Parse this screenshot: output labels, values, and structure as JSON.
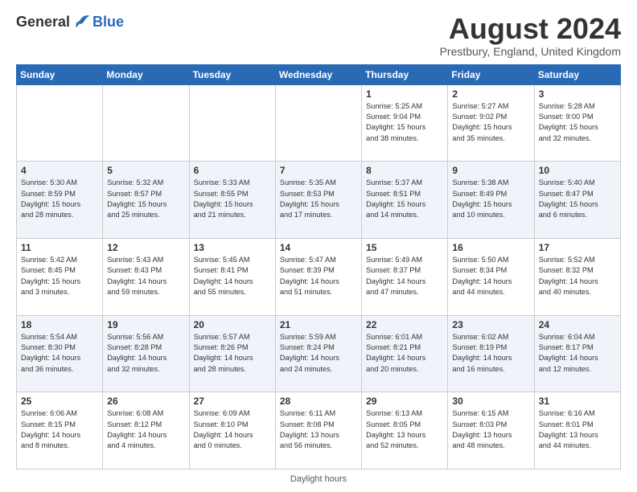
{
  "header": {
    "logo": {
      "general": "General",
      "blue": "Blue"
    },
    "title": "August 2024",
    "location": "Prestbury, England, United Kingdom"
  },
  "days_of_week": [
    "Sunday",
    "Monday",
    "Tuesday",
    "Wednesday",
    "Thursday",
    "Friday",
    "Saturday"
  ],
  "weeks": [
    [
      {
        "day": "",
        "info": ""
      },
      {
        "day": "",
        "info": ""
      },
      {
        "day": "",
        "info": ""
      },
      {
        "day": "",
        "info": ""
      },
      {
        "day": "1",
        "info": "Sunrise: 5:25 AM\nSunset: 9:04 PM\nDaylight: 15 hours\nand 38 minutes."
      },
      {
        "day": "2",
        "info": "Sunrise: 5:27 AM\nSunset: 9:02 PM\nDaylight: 15 hours\nand 35 minutes."
      },
      {
        "day": "3",
        "info": "Sunrise: 5:28 AM\nSunset: 9:00 PM\nDaylight: 15 hours\nand 32 minutes."
      }
    ],
    [
      {
        "day": "4",
        "info": "Sunrise: 5:30 AM\nSunset: 8:59 PM\nDaylight: 15 hours\nand 28 minutes."
      },
      {
        "day": "5",
        "info": "Sunrise: 5:32 AM\nSunset: 8:57 PM\nDaylight: 15 hours\nand 25 minutes."
      },
      {
        "day": "6",
        "info": "Sunrise: 5:33 AM\nSunset: 8:55 PM\nDaylight: 15 hours\nand 21 minutes."
      },
      {
        "day": "7",
        "info": "Sunrise: 5:35 AM\nSunset: 8:53 PM\nDaylight: 15 hours\nand 17 minutes."
      },
      {
        "day": "8",
        "info": "Sunrise: 5:37 AM\nSunset: 8:51 PM\nDaylight: 15 hours\nand 14 minutes."
      },
      {
        "day": "9",
        "info": "Sunrise: 5:38 AM\nSunset: 8:49 PM\nDaylight: 15 hours\nand 10 minutes."
      },
      {
        "day": "10",
        "info": "Sunrise: 5:40 AM\nSunset: 8:47 PM\nDaylight: 15 hours\nand 6 minutes."
      }
    ],
    [
      {
        "day": "11",
        "info": "Sunrise: 5:42 AM\nSunset: 8:45 PM\nDaylight: 15 hours\nand 3 minutes."
      },
      {
        "day": "12",
        "info": "Sunrise: 5:43 AM\nSunset: 8:43 PM\nDaylight: 14 hours\nand 59 minutes."
      },
      {
        "day": "13",
        "info": "Sunrise: 5:45 AM\nSunset: 8:41 PM\nDaylight: 14 hours\nand 55 minutes."
      },
      {
        "day": "14",
        "info": "Sunrise: 5:47 AM\nSunset: 8:39 PM\nDaylight: 14 hours\nand 51 minutes."
      },
      {
        "day": "15",
        "info": "Sunrise: 5:49 AM\nSunset: 8:37 PM\nDaylight: 14 hours\nand 47 minutes."
      },
      {
        "day": "16",
        "info": "Sunrise: 5:50 AM\nSunset: 8:34 PM\nDaylight: 14 hours\nand 44 minutes."
      },
      {
        "day": "17",
        "info": "Sunrise: 5:52 AM\nSunset: 8:32 PM\nDaylight: 14 hours\nand 40 minutes."
      }
    ],
    [
      {
        "day": "18",
        "info": "Sunrise: 5:54 AM\nSunset: 8:30 PM\nDaylight: 14 hours\nand 36 minutes."
      },
      {
        "day": "19",
        "info": "Sunrise: 5:56 AM\nSunset: 8:28 PM\nDaylight: 14 hours\nand 32 minutes."
      },
      {
        "day": "20",
        "info": "Sunrise: 5:57 AM\nSunset: 8:26 PM\nDaylight: 14 hours\nand 28 minutes."
      },
      {
        "day": "21",
        "info": "Sunrise: 5:59 AM\nSunset: 8:24 PM\nDaylight: 14 hours\nand 24 minutes."
      },
      {
        "day": "22",
        "info": "Sunrise: 6:01 AM\nSunset: 8:21 PM\nDaylight: 14 hours\nand 20 minutes."
      },
      {
        "day": "23",
        "info": "Sunrise: 6:02 AM\nSunset: 8:19 PM\nDaylight: 14 hours\nand 16 minutes."
      },
      {
        "day": "24",
        "info": "Sunrise: 6:04 AM\nSunset: 8:17 PM\nDaylight: 14 hours\nand 12 minutes."
      }
    ],
    [
      {
        "day": "25",
        "info": "Sunrise: 6:06 AM\nSunset: 8:15 PM\nDaylight: 14 hours\nand 8 minutes."
      },
      {
        "day": "26",
        "info": "Sunrise: 6:08 AM\nSunset: 8:12 PM\nDaylight: 14 hours\nand 4 minutes."
      },
      {
        "day": "27",
        "info": "Sunrise: 6:09 AM\nSunset: 8:10 PM\nDaylight: 14 hours\nand 0 minutes."
      },
      {
        "day": "28",
        "info": "Sunrise: 6:11 AM\nSunset: 8:08 PM\nDaylight: 13 hours\nand 56 minutes."
      },
      {
        "day": "29",
        "info": "Sunrise: 6:13 AM\nSunset: 8:05 PM\nDaylight: 13 hours\nand 52 minutes."
      },
      {
        "day": "30",
        "info": "Sunrise: 6:15 AM\nSunset: 8:03 PM\nDaylight: 13 hours\nand 48 minutes."
      },
      {
        "day": "31",
        "info": "Sunrise: 6:16 AM\nSunset: 8:01 PM\nDaylight: 13 hours\nand 44 minutes."
      }
    ]
  ],
  "footer": {
    "daylight_hours": "Daylight hours"
  }
}
